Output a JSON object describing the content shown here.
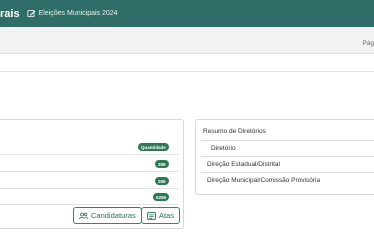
{
  "header": {
    "brand_fragment": "rais",
    "election_label": "Eleições Municipais 2024"
  },
  "breadcrumb": {
    "page_label": "Pág"
  },
  "summary_panel": {
    "header_badge": "Quantidade",
    "counts": [
      "259",
      "259",
      "5259"
    ],
    "buttons": {
      "candidaturas": "Candidaturas",
      "atas": "Atas"
    }
  },
  "directories": {
    "title": "Resumo de Diretórios",
    "header": "Diretório",
    "rows": [
      "Direção Estadual/Distrital",
      "Direção Municipal/Comissão Provisória"
    ]
  },
  "colors": {
    "topbar": "#2f6e68",
    "badge": "#2c7a55",
    "button_border": "#3c7f78"
  },
  "icons": [
    "edit-icon",
    "users-icon",
    "document-icon"
  ]
}
